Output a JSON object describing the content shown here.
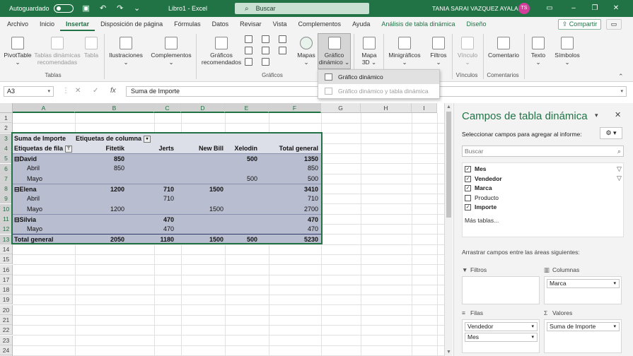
{
  "titlebar": {
    "autosave": "Autoguardado",
    "doc_title": "Libro1 - Excel",
    "search": "Buscar",
    "user": "TANIA SARAI VAZQUEZ AYALA",
    "initials": "TS"
  },
  "tabs": [
    "Archivo",
    "Inicio",
    "Insertar",
    "Disposición de página",
    "Fórmulas",
    "Datos",
    "Revisar",
    "Vista",
    "Complementos",
    "Ayuda",
    "Análisis de tabla dinámica",
    "Diseño"
  ],
  "share": "Compartir",
  "ribbon": {
    "pivottable": "PivotTable",
    "recommended_tables": "Tablas dinámicas recomendadas",
    "table": "Tabla",
    "illustrations": "Ilustraciones",
    "addins": "Complementos",
    "recommended_charts": "Gráficos recomendados",
    "maps": "Mapas",
    "pivot_chart": "Gráfico dinámico",
    "map3d": "Mapa 3D",
    "sparklines": "Minigráficos",
    "filters": "Filtros",
    "link": "Vínculo",
    "comment": "Comentario",
    "text": "Texto",
    "symbols": "Símbolos",
    "groups": {
      "tables": "Tablas",
      "charts": "Gráficos",
      "links": "Vínculos",
      "comments": "Comentarios"
    }
  },
  "dropdown": {
    "items": [
      "Gráfico dinámico",
      "Gráfico dinámico y tabla dinámica"
    ]
  },
  "formula": {
    "name_box": "A3",
    "content": "Suma de Importe"
  },
  "columns": [
    "A",
    "B",
    "C",
    "D",
    "E",
    "F",
    "G",
    "H",
    "I"
  ],
  "rows": [
    "1",
    "2",
    "3",
    "4",
    "5",
    "6",
    "7",
    "8",
    "9",
    "10",
    "11",
    "12",
    "13",
    "14",
    "15",
    "16",
    "17",
    "18",
    "19",
    "20",
    "21",
    "22",
    "23",
    "24",
    "25"
  ],
  "pivot": {
    "corner": "Suma de Importe",
    "col_label": "Etiquetas de columna",
    "row_label": "Etiquetas de fila",
    "headers": [
      "Fitetik",
      "Jerts",
      "New Bill",
      "Xelodin",
      "Total general"
    ],
    "rows": [
      {
        "label": "David",
        "level": 0,
        "values": [
          "850",
          "",
          "",
          "500",
          "1350"
        ]
      },
      {
        "label": "Abril",
        "level": 1,
        "values": [
          "850",
          "",
          "",
          "",
          "850"
        ]
      },
      {
        "label": "Mayo",
        "level": 1,
        "values": [
          "",
          "",
          "",
          "500",
          "500"
        ]
      },
      {
        "label": "Elena",
        "level": 0,
        "values": [
          "1200",
          "710",
          "1500",
          "",
          "3410"
        ]
      },
      {
        "label": "Abril",
        "level": 1,
        "values": [
          "",
          "710",
          "",
          "",
          "710"
        ]
      },
      {
        "label": "Mayo",
        "level": 1,
        "values": [
          "1200",
          "",
          "1500",
          "",
          "2700"
        ]
      },
      {
        "label": "Silvia",
        "level": 0,
        "values": [
          "",
          "470",
          "",
          "",
          "470"
        ]
      },
      {
        "label": "Mayo",
        "level": 1,
        "values": [
          "",
          "470",
          "",
          "",
          "470"
        ]
      }
    ],
    "total": {
      "label": "Total general",
      "values": [
        "2050",
        "1180",
        "1500",
        "500",
        "5230"
      ]
    }
  },
  "panel": {
    "title": "Campos de tabla dinámica",
    "subtitle": "Seleccionar campos para agregar al informe:",
    "search": "Buscar",
    "fields": [
      {
        "name": "Mes",
        "checked": true
      },
      {
        "name": "Vendedor",
        "checked": true
      },
      {
        "name": "Marca",
        "checked": true
      },
      {
        "name": "Producto",
        "checked": false
      },
      {
        "name": "Importe",
        "checked": true
      }
    ],
    "more": "Más tablas...",
    "drag": "Arrastrar campos entre las áreas siguientes:",
    "filters": "Filtros",
    "columns": "Columnas",
    "rows": "Filas",
    "values": "Valores",
    "columns_items": [
      "Marca"
    ],
    "rows_items": [
      "Vendedor",
      "Mes"
    ],
    "values_items": [
      "Suma de Importe"
    ]
  }
}
